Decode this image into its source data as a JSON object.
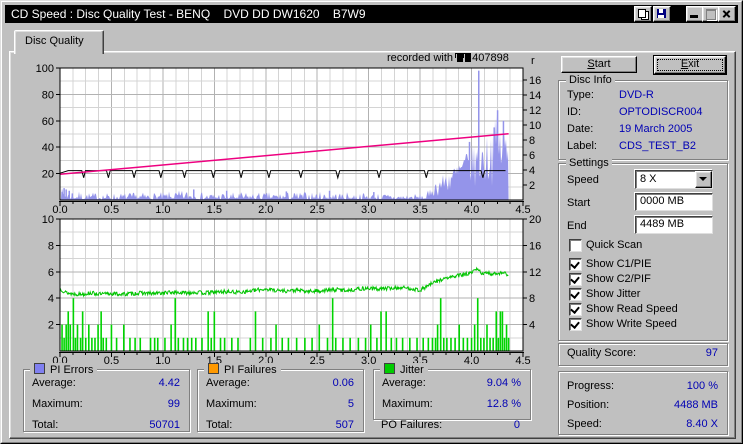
{
  "window": {
    "title": "CD Speed : Disc Quality Test - BENQ    DVD DD DW1620    B7W9"
  },
  "tab": {
    "label": "Disc Quality"
  },
  "recorded_with": {
    "text": "recorded with",
    "serial": "407898",
    "corner": "r"
  },
  "controls": {
    "start": "Start",
    "exit": "Exit"
  },
  "disc_info": {
    "title": "Disc Info",
    "rows": [
      {
        "label": "Type:",
        "value": "DVD-R"
      },
      {
        "label": "ID:",
        "value": "OPTODISCR004"
      },
      {
        "label": "Date:",
        "value": "19 March 2005"
      },
      {
        "label": "Label:",
        "value": "CDS_TEST_B2"
      }
    ]
  },
  "settings": {
    "title": "Settings",
    "speed_label": "Speed",
    "speed_value": "8 X",
    "start_label": "Start",
    "start_value": "0000 MB",
    "end_label": "End",
    "end_value": "4489 MB",
    "checkboxes": [
      {
        "label": "Quick Scan",
        "checked": false
      },
      {
        "label": "Show C1/PIE",
        "checked": true
      },
      {
        "label": "Show C2/PIF",
        "checked": true
      },
      {
        "label": "Show Jitter",
        "checked": true
      },
      {
        "label": "Show Read Speed",
        "checked": true
      },
      {
        "label": "Show Write Speed",
        "checked": true
      }
    ]
  },
  "quality": {
    "label": "Quality Score:",
    "value": "97"
  },
  "progress": {
    "rows": [
      {
        "label": "Progress:",
        "value": "100 %"
      },
      {
        "label": "Position:",
        "value": "4488 MB"
      },
      {
        "label": "Speed:",
        "value": "8.40 X"
      }
    ]
  },
  "stats": [
    {
      "title": "PI Errors",
      "color": "#8080f0",
      "rows": [
        {
          "label": "Average:",
          "value": "4.42"
        },
        {
          "label": "Maximum:",
          "value": "99"
        },
        {
          "label": "Total:",
          "value": "50701"
        }
      ]
    },
    {
      "title": "PI Failures",
      "color": "#ff9900",
      "rows": [
        {
          "label": "Average:",
          "value": "0.06"
        },
        {
          "label": "Maximum:",
          "value": "5"
        },
        {
          "label": "Total:",
          "value": "507"
        }
      ]
    },
    {
      "title": "Jitter",
      "color": "#00cc00",
      "rows": [
        {
          "label": "Average:",
          "value": "9.04 %"
        },
        {
          "label": "Maximum:",
          "value": "12.8 %"
        }
      ]
    }
  ],
  "po_failures": {
    "label": "PO Failures:",
    "value": "0"
  },
  "chart_data": [
    {
      "type": "line",
      "title": "C1/PIE errors, read and write speed vs disc position (GB)",
      "x_max": 4.5,
      "x_ticks": [
        "0.0",
        "0.5",
        "1.0",
        "1.5",
        "2.0",
        "2.5",
        "3.0",
        "3.5",
        "4.0",
        "4.5"
      ],
      "x_minor_step": 0.125,
      "left_axis": {
        "max": 100,
        "ticks": [
          20,
          40,
          60,
          80,
          100
        ],
        "minor_step": 10
      },
      "right_axis": {
        "max": 17.6,
        "ticks": [
          2,
          4,
          6,
          8,
          10,
          12,
          14,
          16
        ]
      },
      "series": [
        {
          "name": "C1/PIE",
          "type": "area_noise",
          "color": "#9494ea",
          "seed": 7,
          "x_end": 4.36,
          "tail_from": 3.6,
          "envelope": [
            [
              0,
              9
            ],
            [
              0.06,
              10
            ],
            [
              0.12,
              7
            ],
            [
              0.3,
              6
            ],
            [
              0.5,
              5.5
            ],
            [
              1,
              6
            ],
            [
              1.25,
              8
            ],
            [
              1.3,
              9
            ],
            [
              1.35,
              6
            ],
            [
              2,
              6
            ],
            [
              2.5,
              6.5
            ],
            [
              3,
              5.5
            ],
            [
              3.3,
              5
            ],
            [
              3.55,
              5
            ],
            [
              3.6,
              9
            ],
            [
              3.65,
              14
            ],
            [
              3.7,
              18
            ],
            [
              3.75,
              22
            ],
            [
              3.8,
              26
            ],
            [
              3.85,
              28
            ],
            [
              3.9,
              34
            ],
            [
              3.95,
              38
            ],
            [
              4,
              42
            ],
            [
              4.05,
              44
            ],
            [
              4.1,
              46
            ],
            [
              4.15,
              50
            ],
            [
              4.2,
              58
            ],
            [
              4.25,
              66
            ],
            [
              4.28,
              58
            ],
            [
              4.31,
              62
            ],
            [
              4.33,
              57
            ],
            [
              4.36,
              50
            ]
          ],
          "spikes": [
            [
              0.02,
              6
            ],
            [
              0.04,
              9
            ],
            [
              0.06,
              8
            ],
            [
              0.09,
              7
            ],
            [
              0.12,
              5
            ],
            [
              1.3,
              8
            ],
            [
              1.62,
              7
            ],
            [
              2.2,
              6.5
            ],
            [
              2.62,
              7
            ],
            [
              3.05,
              6
            ],
            [
              3.98,
              44
            ],
            [
              4.07,
              98
            ],
            [
              4.22,
              55
            ],
            [
              4.253,
              68
            ],
            [
              4.31,
              60
            ]
          ]
        },
        {
          "name": "Read Speed",
          "type": "hline_dips",
          "color": "#000000",
          "baseline": 22.3,
          "intro": [
            [
              0,
              20.3
            ],
            [
              0.08,
              22.3
            ]
          ],
          "x_end": 4.33,
          "dips": [
            0.23,
            0.47,
            0.72,
            0.98,
            1.21,
            1.49,
            1.76,
            2.03,
            2.34,
            2.7,
            3.1,
            3.56,
            4.11
          ],
          "dip_value": 16.8,
          "dip_halfwidth": 0.018
        },
        {
          "name": "Write Speed",
          "type": "line",
          "color": "#ee0080",
          "width": 1.5,
          "points": [
            [
              0,
              19.5
            ],
            [
              4.36,
              50.2
            ]
          ]
        }
      ]
    },
    {
      "type": "line",
      "title": "C2/PIF errors and jitter vs disc position (GB)",
      "x_max": 4.5,
      "x_ticks": [
        "0.0",
        "0.5",
        "1.0",
        "1.5",
        "2.0",
        "2.5",
        "3.0",
        "3.5",
        "4.0",
        "4.5"
      ],
      "x_minor_step": 0.125,
      "left_axis": {
        "max": 10,
        "ticks": [
          2,
          4,
          6,
          8,
          10
        ],
        "minor_step": 1
      },
      "right_axis": {
        "max": 20,
        "ticks": [
          4,
          8,
          12,
          16,
          20
        ]
      },
      "series": [
        {
          "name": "C2/PIF",
          "type": "bars",
          "color": "#00d400",
          "bars": [
            [
              0.02,
              2
            ],
            [
              0.04,
              1
            ],
            [
              0.06,
              2
            ],
            [
              0.08,
              3
            ],
            [
              0.1,
              2
            ],
            [
              0.13,
              4
            ],
            [
              0.15,
              1
            ],
            [
              0.17,
              2
            ],
            [
              0.2,
              1
            ],
            [
              0.22,
              3
            ],
            [
              0.25,
              1
            ],
            [
              0.28,
              2
            ],
            [
              0.31,
              1
            ],
            [
              0.34,
              1
            ],
            [
              0.37,
              2
            ],
            [
              0.4,
              3
            ],
            [
              0.42,
              1
            ],
            [
              0.45,
              1
            ],
            [
              0.5,
              2
            ],
            [
              0.55,
              1
            ],
            [
              0.62,
              2
            ],
            [
              0.68,
              1
            ],
            [
              0.73,
              1
            ],
            [
              0.78,
              1
            ],
            [
              0.88,
              1
            ],
            [
              0.92,
              1
            ],
            [
              0.95,
              1
            ],
            [
              1.02,
              1
            ],
            [
              1.08,
              2
            ],
            [
              1.12,
              4
            ],
            [
              1.15,
              1
            ],
            [
              1.2,
              1
            ],
            [
              1.24,
              1
            ],
            [
              1.28,
              1
            ],
            [
              1.32,
              1
            ],
            [
              1.38,
              1
            ],
            [
              1.44,
              3
            ],
            [
              1.47,
              1
            ],
            [
              1.5,
              3
            ],
            [
              1.56,
              1
            ],
            [
              1.6,
              1
            ],
            [
              1.67,
              1
            ],
            [
              1.73,
              1
            ],
            [
              1.85,
              1
            ],
            [
              1.9,
              3
            ],
            [
              1.97,
              1
            ],
            [
              2.05,
              1
            ],
            [
              2.1,
              2
            ],
            [
              2.16,
              1
            ],
            [
              2.22,
              1
            ],
            [
              2.3,
              1
            ],
            [
              2.38,
              1
            ],
            [
              2.45,
              1
            ],
            [
              2.52,
              2
            ],
            [
              2.6,
              1
            ],
            [
              2.65,
              4
            ],
            [
              2.68,
              1
            ],
            [
              2.75,
              1
            ],
            [
              2.82,
              1
            ],
            [
              2.9,
              1
            ],
            [
              2.97,
              1
            ],
            [
              3.02,
              2
            ],
            [
              3.08,
              1
            ],
            [
              3.12,
              3
            ],
            [
              3.17,
              3
            ],
            [
              3.22,
              1
            ],
            [
              3.27,
              1
            ],
            [
              3.33,
              1
            ],
            [
              3.4,
              1
            ],
            [
              3.47,
              1
            ],
            [
              3.53,
              1
            ],
            [
              3.58,
              1
            ],
            [
              3.62,
              1
            ],
            [
              3.65,
              1
            ],
            [
              3.67,
              2
            ],
            [
              3.7,
              4
            ],
            [
              3.73,
              1
            ],
            [
              3.76,
              1
            ],
            [
              3.8,
              1
            ],
            [
              3.84,
              1
            ],
            [
              3.88,
              2
            ],
            [
              3.92,
              1
            ],
            [
              3.96,
              1
            ],
            [
              4,
              1
            ],
            [
              4.03,
              2
            ],
            [
              4.06,
              4
            ],
            [
              4.09,
              1
            ],
            [
              4.12,
              1
            ],
            [
              4.15,
              2
            ],
            [
              4.18,
              1
            ],
            [
              4.21,
              1
            ],
            [
              4.24,
              3
            ],
            [
              4.26,
              1
            ],
            [
              4.28,
              3
            ],
            [
              4.3,
              3
            ],
            [
              4.32,
              1
            ],
            [
              4.34,
              2
            ],
            [
              4.36,
              1
            ]
          ]
        },
        {
          "name": "Jitter",
          "type": "line_noise",
          "color": "#00c400",
          "seed": 13,
          "noise": 0.3,
          "step": 0.006,
          "x_end": 4.36,
          "points": [
            [
              0,
              4.75
            ],
            [
              0.05,
              4.45
            ],
            [
              0.1,
              4.35
            ],
            [
              0.2,
              4.3
            ],
            [
              0.3,
              4.4
            ],
            [
              0.4,
              4.3
            ],
            [
              0.5,
              4.35
            ],
            [
              0.6,
              4.3
            ],
            [
              0.7,
              4.35
            ],
            [
              0.8,
              4.4
            ],
            [
              0.9,
              4.35
            ],
            [
              1,
              4.4
            ],
            [
              1.1,
              4.45
            ],
            [
              1.2,
              4.4
            ],
            [
              1.3,
              4.45
            ],
            [
              1.4,
              4.4
            ],
            [
              1.5,
              4.45
            ],
            [
              1.6,
              4.5
            ],
            [
              1.7,
              4.45
            ],
            [
              1.8,
              4.5
            ],
            [
              1.9,
              4.6
            ],
            [
              2,
              4.7
            ],
            [
              2.1,
              4.6
            ],
            [
              2.2,
              4.55
            ],
            [
              2.3,
              4.6
            ],
            [
              2.4,
              4.5
            ],
            [
              2.5,
              4.55
            ],
            [
              2.6,
              4.6
            ],
            [
              2.7,
              4.65
            ],
            [
              2.8,
              4.6
            ],
            [
              2.9,
              4.7
            ],
            [
              3,
              4.75
            ],
            [
              3.1,
              4.7
            ],
            [
              3.2,
              4.75
            ],
            [
              3.3,
              4.8
            ],
            [
              3.4,
              4.75
            ],
            [
              3.5,
              4.6
            ],
            [
              3.6,
              5.05
            ],
            [
              3.7,
              5.4
            ],
            [
              3.8,
              5.6
            ],
            [
              3.9,
              5.75
            ],
            [
              4,
              5.9
            ],
            [
              4.05,
              6.2
            ],
            [
              4.1,
              5.9
            ],
            [
              4.2,
              5.85
            ],
            [
              4.3,
              5.95
            ],
            [
              4.36,
              5.8
            ]
          ]
        }
      ]
    }
  ]
}
